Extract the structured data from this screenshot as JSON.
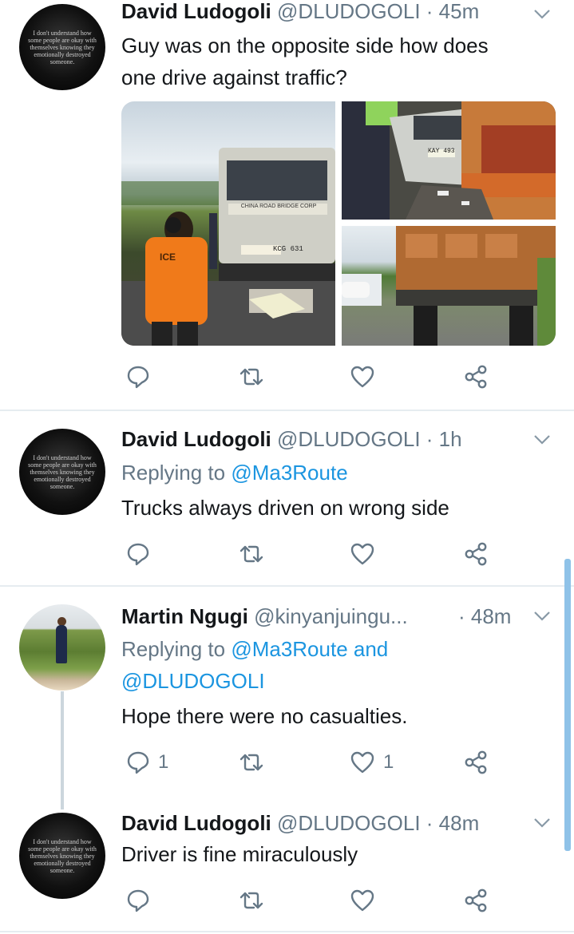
{
  "tweets": [
    {
      "name": "David Ludogoli",
      "handle": "@DLUDOGOLI",
      "time": "· 45m",
      "avatar_text": "I don't understand how some people are okay with themselves knowing they emotionally destroyed someone.",
      "text_lines": [
        "Guy was on the opposite side how does",
        "one drive against traffic?"
      ],
      "actions": {
        "reply": "",
        "retweet": "",
        "like": ""
      }
    },
    {
      "name": "David Ludogoli",
      "handle": "@DLUDOGOLI",
      "time": "· 1h",
      "avatar_text": "I don't understand how some people are okay with themselves knowing they emotionally destroyed someone.",
      "replying_label": "Replying to",
      "replying_to": "@Ma3Route",
      "text": "Trucks always driven on wrong side",
      "actions": {
        "reply": "",
        "retweet": "",
        "like": ""
      }
    },
    {
      "name": "Martin Ngugi",
      "handle": "@kinyanjuingu...",
      "time": "· 48m",
      "replying_label": "Replying to",
      "replying_to": "@Ma3Route and",
      "replying_to_2": "@DLUDOGOLI",
      "text": "Hope there were no casualties.",
      "actions": {
        "reply": "1",
        "retweet": "",
        "like": "1"
      }
    },
    {
      "name": "David Ludogoli",
      "handle": "@DLUDOGOLI",
      "time": "· 48m",
      "avatar_text": "I don't understand how some people are okay with themselves knowing they emotionally destroyed someone.",
      "text": "Driver is fine miraculously",
      "actions": {
        "reply": "",
        "retweet": "",
        "like": ""
      }
    }
  ],
  "images": {
    "left_plate": "KCG 631",
    "top_right_plate": "KAY 493",
    "truck_front_text": "CHINA ROAD BRIDGE CORP",
    "vest_text": "ICE"
  },
  "colors": {
    "icon": "#657786",
    "mention": "#1b95e0",
    "divider": "#e6ecf0"
  }
}
